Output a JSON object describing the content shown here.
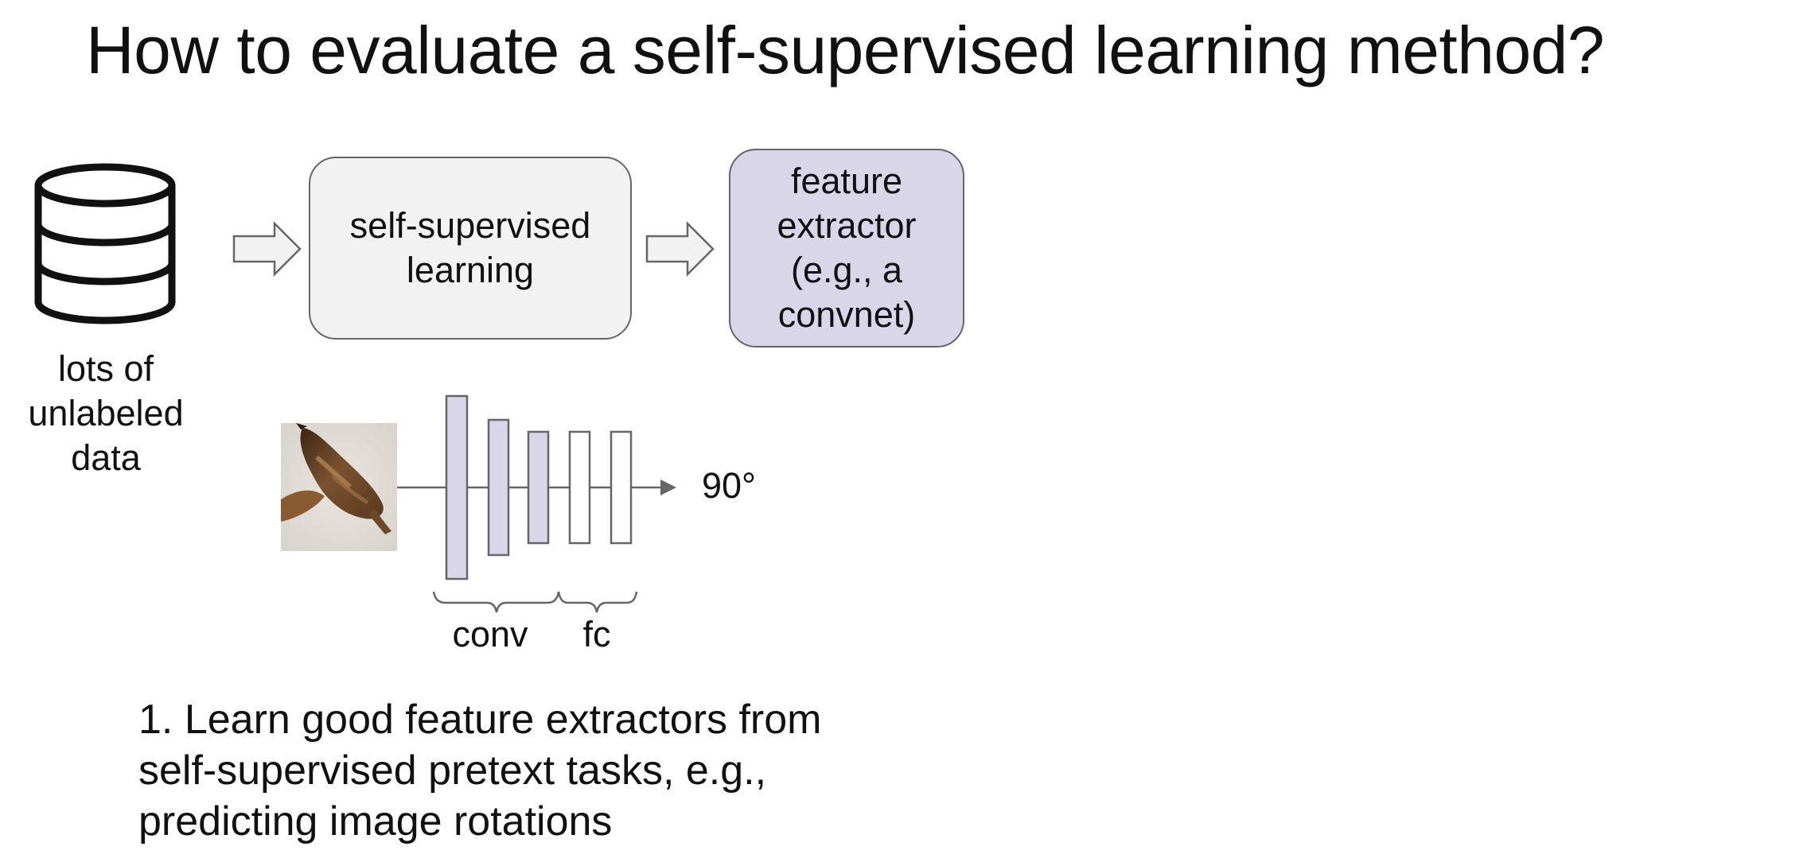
{
  "slide": {
    "title": "How to evaluate a self-supervised learning method?",
    "colors": {
      "ssl_box_fill": "#f2f2f2",
      "feature_box_fill": "#d9d6ea",
      "layer_fill": "#d9d6ea",
      "arrow_fill": "#f2f2f2",
      "outline": "#666666"
    }
  },
  "diagram": {
    "database": {
      "icon": "database-icon",
      "label_lines": [
        "lots of",
        "unlabeled",
        "data"
      ]
    },
    "ssl_box": {
      "lines": [
        "self-supervised",
        "learning"
      ]
    },
    "feature_box": {
      "lines": [
        "feature",
        "extractor",
        "(e.g., a",
        "convnet)"
      ]
    },
    "network": {
      "input_image": "bird-image",
      "output_label": "90°",
      "conv_label": "conv",
      "fc_label": "fc",
      "layers": [
        {
          "type": "conv"
        },
        {
          "type": "conv"
        },
        {
          "type": "conv"
        },
        {
          "type": "fc"
        },
        {
          "type": "fc"
        }
      ]
    }
  },
  "body": {
    "lines": [
      "1. Learn good feature extractors from",
      "self-supervised pretext tasks, e.g.,",
      "predicting image rotations"
    ]
  }
}
